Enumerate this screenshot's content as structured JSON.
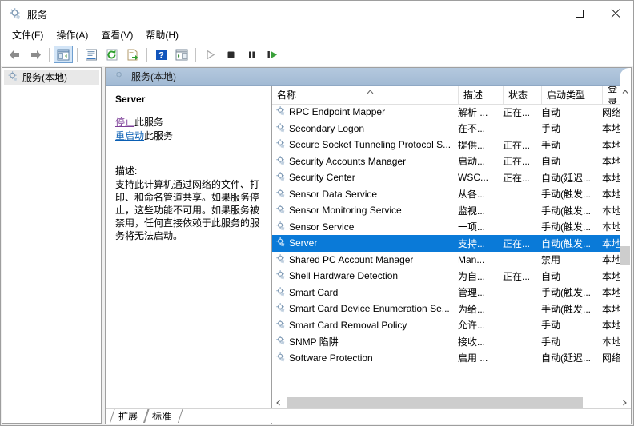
{
  "window": {
    "title": "服务",
    "icon": "services-gear-icon",
    "minimize_label": "最小化",
    "maximize_label": "最大化",
    "close_label": "关闭"
  },
  "menu": {
    "items": [
      {
        "label": "文件(F)",
        "name": "menu-file"
      },
      {
        "label": "操作(A)",
        "name": "menu-action"
      },
      {
        "label": "查看(V)",
        "name": "menu-view"
      },
      {
        "label": "帮助(H)",
        "name": "menu-help"
      }
    ]
  },
  "toolbar": {
    "buttons": [
      {
        "name": "back-icon",
        "title": "后退"
      },
      {
        "name": "forward-icon",
        "title": "前进"
      },
      {
        "name": "show-hide-tree-icon",
        "title": "显示/隐藏控制台树"
      },
      {
        "name": "properties-icon",
        "title": "属性"
      },
      {
        "name": "refresh-icon",
        "title": "刷新"
      },
      {
        "name": "export-list-icon",
        "title": "导出列表"
      },
      {
        "name": "help-icon",
        "title": "帮助"
      },
      {
        "name": "show-action-pane-icon",
        "title": "显示/隐藏操作窗格"
      },
      {
        "name": "start-service-icon",
        "title": "启动服务"
      },
      {
        "name": "stop-service-icon",
        "title": "停止服务"
      },
      {
        "name": "pause-service-icon",
        "title": "暂停服务"
      },
      {
        "name": "restart-service-icon",
        "title": "重启动服务"
      }
    ]
  },
  "tree": {
    "items": [
      {
        "label": "服务(本地)",
        "name": "tree-item-services-local",
        "icon": "services-gear-icon",
        "selected": true
      }
    ]
  },
  "pane": {
    "header": "服务(本地)",
    "header_icon": "services-gear-icon"
  },
  "detail": {
    "service_name": "Server",
    "actions": [
      {
        "link": "停止",
        "suffix": "此服务",
        "name": "stop-service-link",
        "style": "visited"
      },
      {
        "link": "重启动",
        "suffix": "此服务",
        "name": "restart-service-link",
        "style": "normal"
      }
    ],
    "description_label": "描述:",
    "description_text": "支持此计算机通过网络的文件、打印、和命名管道共享。如果服务停止，这些功能不可用。如果服务被禁用，任何直接依赖于此服务的服务将无法启动。"
  },
  "list": {
    "columns": [
      {
        "label": "名称",
        "name": "column-header-name",
        "sorted": "asc"
      },
      {
        "label": "描述",
        "name": "column-header-description"
      },
      {
        "label": "状态",
        "name": "column-header-status"
      },
      {
        "label": "启动类型",
        "name": "column-header-startup-type"
      },
      {
        "label": "登录",
        "name": "column-header-log-on-as"
      }
    ],
    "rows": [
      {
        "name": "RPC Endpoint Mapper",
        "description": "解析 ...",
        "status": "正在...",
        "startup": "自动",
        "logon": "网络",
        "selected": false
      },
      {
        "name": "Secondary Logon",
        "description": "在不...",
        "status": "",
        "startup": "手动",
        "logon": "本地",
        "selected": false
      },
      {
        "name": "Secure Socket Tunneling Protocol S...",
        "description": "提供...",
        "status": "正在...",
        "startup": "手动",
        "logon": "本地",
        "selected": false
      },
      {
        "name": "Security Accounts Manager",
        "description": "启动...",
        "status": "正在...",
        "startup": "自动",
        "logon": "本地",
        "selected": false
      },
      {
        "name": "Security Center",
        "description": "WSC...",
        "status": "正在...",
        "startup": "自动(延迟...",
        "logon": "本地",
        "selected": false
      },
      {
        "name": "Sensor Data Service",
        "description": "从各...",
        "status": "",
        "startup": "手动(触发...",
        "logon": "本地",
        "selected": false
      },
      {
        "name": "Sensor Monitoring Service",
        "description": "监视...",
        "status": "",
        "startup": "手动(触发...",
        "logon": "本地",
        "selected": false
      },
      {
        "name": "Sensor Service",
        "description": "一项...",
        "status": "",
        "startup": "手动(触发...",
        "logon": "本地",
        "selected": false
      },
      {
        "name": "Server",
        "description": "支持...",
        "status": "正在...",
        "startup": "自动(触发...",
        "logon": "本地",
        "selected": true
      },
      {
        "name": "Shared PC Account Manager",
        "description": "Man...",
        "status": "",
        "startup": "禁用",
        "logon": "本地",
        "selected": false
      },
      {
        "name": "Shell Hardware Detection",
        "description": "为自...",
        "status": "正在...",
        "startup": "自动",
        "logon": "本地",
        "selected": false
      },
      {
        "name": "Smart Card",
        "description": "管理...",
        "status": "",
        "startup": "手动(触发...",
        "logon": "本地",
        "selected": false
      },
      {
        "name": "Smart Card Device Enumeration Se...",
        "description": "为给...",
        "status": "",
        "startup": "手动(触发...",
        "logon": "本地",
        "selected": false
      },
      {
        "name": "Smart Card Removal Policy",
        "description": "允许...",
        "status": "",
        "startup": "手动",
        "logon": "本地",
        "selected": false
      },
      {
        "name": "SNMP 陷阱",
        "description": "接收...",
        "status": "",
        "startup": "手动",
        "logon": "本地",
        "selected": false
      },
      {
        "name": "Software Protection",
        "description": "启用 ...",
        "status": "",
        "startup": "自动(延迟...",
        "logon": "网络",
        "selected": false
      }
    ]
  },
  "tabs": [
    {
      "label": "扩展",
      "name": "tab-extended",
      "active": false
    },
    {
      "label": "标准",
      "name": "tab-standard",
      "active": true
    }
  ],
  "colors": {
    "selection_blue": "#0a7ad8",
    "pane_header": "#a9c0da",
    "link_visited": "#7d3f98",
    "link_normal": "#0a5fb4",
    "scrollbar_thumb": "#cdcdcd"
  }
}
